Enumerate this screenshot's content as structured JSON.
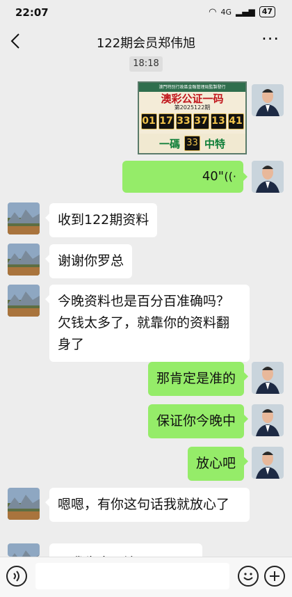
{
  "status": {
    "time": "22:07",
    "signal": "4G",
    "battery": "47"
  },
  "header": {
    "title": "122期会员郑伟旭"
  },
  "chat_timestamp": "18:18",
  "lottery_image": {
    "top_text": "澳門特別行政區金融管理局監製發行",
    "brand": "澳彩公证一码",
    "period": "第2025122期",
    "numbers": [
      "01",
      "17",
      "33",
      "37",
      "13",
      "41"
    ],
    "bottom_left": "一碼",
    "special": "33",
    "bottom_right": "中特"
  },
  "voice_message": {
    "duration": "40\""
  },
  "messages": [
    {
      "side": "left",
      "text": "收到122期资料"
    },
    {
      "side": "left",
      "text": "谢谢你罗总"
    },
    {
      "side": "left",
      "text": "今晚资料也是百分百准确吗？欠钱太多了，就靠你的资料翻身了"
    },
    {
      "side": "right",
      "text": "那肯定是准的"
    },
    {
      "side": "right",
      "text": "保证你今晚中"
    },
    {
      "side": "right",
      "text": "放心吧"
    },
    {
      "side": "left",
      "text": "嗯嗯，有你这句话我就放心了"
    },
    {
      "side": "left",
      "text": "那我先去下注"
    }
  ],
  "icons": {
    "voice_toggle": "voice-icon",
    "emoji": "emoji-icon",
    "add": "plus-icon"
  }
}
